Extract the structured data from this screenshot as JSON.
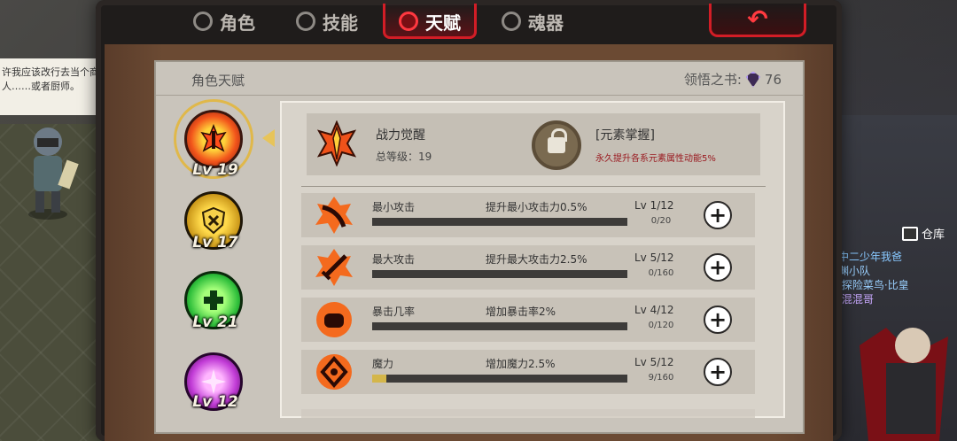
{
  "tabs": [
    {
      "label": "角色",
      "icon": "character-icon",
      "active": false
    },
    {
      "label": "技能",
      "icon": "skill-icon",
      "active": false
    },
    {
      "label": "天赋",
      "icon": "talent-icon",
      "active": true
    },
    {
      "label": "魂器",
      "icon": "soul-vessel-icon",
      "active": false
    }
  ],
  "back_button": {
    "icon": "back-arrow-icon",
    "glyph": "↶"
  },
  "chat": {
    "line1": "许我应该改行去当个商",
    "line2": "人……或者厨师。"
  },
  "scene": {
    "warehouse_label": "仓库",
    "names": [
      "中二少年我爸",
      "渊小队",
      "·探险菜鸟·比皇",
      "·混混哥"
    ]
  },
  "panel": {
    "title": "角色天赋",
    "book_label": "领悟之书:",
    "book_count": "76"
  },
  "talent_icons": [
    {
      "level": "Lv 19",
      "color": "red",
      "selected": true
    },
    {
      "level": "Lv 17",
      "color": "yellow",
      "selected": false
    },
    {
      "level": "Lv 21",
      "color": "green",
      "selected": false
    },
    {
      "level": "Lv 12",
      "color": "purple",
      "selected": false
    }
  ],
  "summary": {
    "name": "战力觉醒",
    "total_level": "总等级：19",
    "element_name": "[元素掌握]",
    "element_desc": "永久提升各系元素属性动能5%"
  },
  "rows": [
    {
      "icon": "slash-icon",
      "name": "最小攻击",
      "effect": "提升最小攻击力0.5%",
      "level": "Lv 1/12",
      "xp": "0/20",
      "progress": 0
    },
    {
      "icon": "sword-icon",
      "name": "最大攻击",
      "effect": "提升最大攻击力2.5%",
      "level": "Lv 5/12",
      "xp": "0/160",
      "progress": 0
    },
    {
      "icon": "fist-icon",
      "name": "暴击几率",
      "effect": "增加暴击率2%",
      "level": "Lv 4/12",
      "xp": "0/120",
      "progress": 0
    },
    {
      "icon": "magic-rune-icon",
      "name": "魔力",
      "effect": "增加魔力2.5%",
      "level": "Lv 5/12",
      "xp": "9/160",
      "progress": 0.056
    }
  ],
  "colors": {
    "accent_red": "#d21d26",
    "bar_fill": "#d4b64a",
    "desc_red": "#9a1a20"
  }
}
